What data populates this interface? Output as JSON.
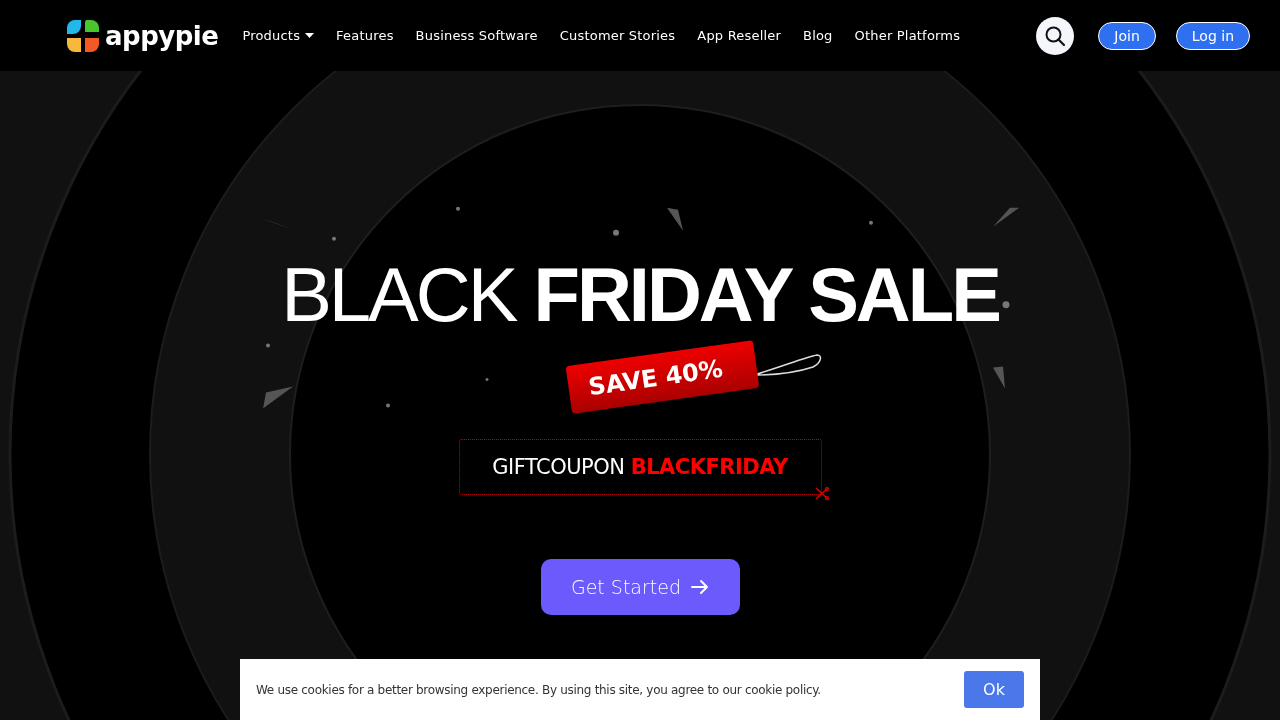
{
  "header": {
    "logo": "appypie",
    "nav": [
      {
        "label": "Products",
        "dropdown": true
      },
      {
        "label": "Features",
        "dropdown": false
      },
      {
        "label": "Business Software",
        "dropdown": false
      },
      {
        "label": "Customer Stories",
        "dropdown": false
      },
      {
        "label": "App Reseller",
        "dropdown": false
      },
      {
        "label": "Blog",
        "dropdown": false
      },
      {
        "label": "Other Platforms",
        "dropdown": false
      }
    ],
    "buttons": [
      "Join",
      "Log in"
    ]
  },
  "hero": {
    "title": "BLACK **FRIDAY SALE**",
    "tag": "SAVE 40%",
    "coupon": "GIFTCOUPON **BLACKFRIDAY**",
    "cta": "Get Started"
  },
  "cookie_banner": {
    "text": "We use cookies for a better browsing experience. By using this site, you agree to our cookie policy.",
    "button": "Ok"
  }
}
